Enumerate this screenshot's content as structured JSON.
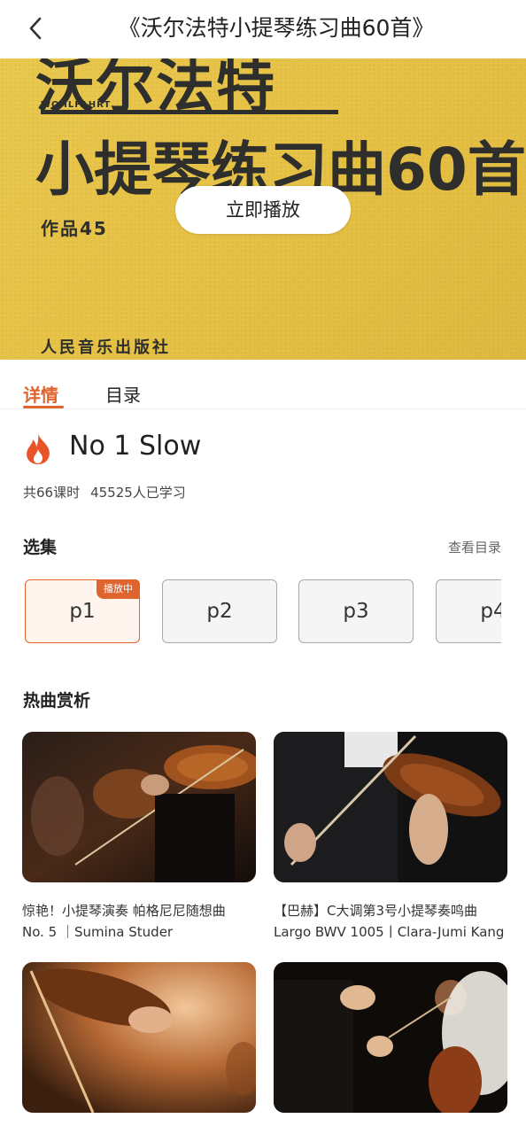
{
  "header": {
    "title": "《沃尔法特小提琴练习曲60首》",
    "back_icon": "chevron-left-icon"
  },
  "banner": {
    "cover_line1": "沃尔法特",
    "cover_subtitle": "WOHLFAHRT",
    "cover_line2": "小提琴练习曲60首",
    "cover_opus": "作品45",
    "cover_publisher": "人民音乐出版社",
    "play_label": "立即播放",
    "bg_color": "#e6c246"
  },
  "tabs": [
    {
      "label": "详情",
      "active": true
    },
    {
      "label": "目录",
      "active": false
    }
  ],
  "lesson": {
    "icon": "fire-icon",
    "title": "No 1 Slow",
    "lessons_count": "共66课时",
    "learners": "45525人已学习"
  },
  "episodes_section": {
    "title": "选集",
    "view_catalog": "查看目录",
    "playing_badge": "播放中",
    "items": [
      "p1",
      "p2",
      "p3",
      "p4"
    ]
  },
  "hot_section": {
    "title": "热曲赏析",
    "cards": [
      {
        "line1": "惊艳！小提琴演奏 帕格尼尼随想曲",
        "line2": "No. 5 ｜Sumina Studer"
      },
      {
        "line1": "【巴赫】C大调第3号小提琴奏鸣曲",
        "line2": "Largo BWV 1005丨Clara-Jumi Kang"
      },
      {
        "line1": "",
        "line2": ""
      },
      {
        "line1": "",
        "line2": ""
      }
    ]
  },
  "colors": {
    "accent": "#e0642d",
    "text": "#222222"
  }
}
